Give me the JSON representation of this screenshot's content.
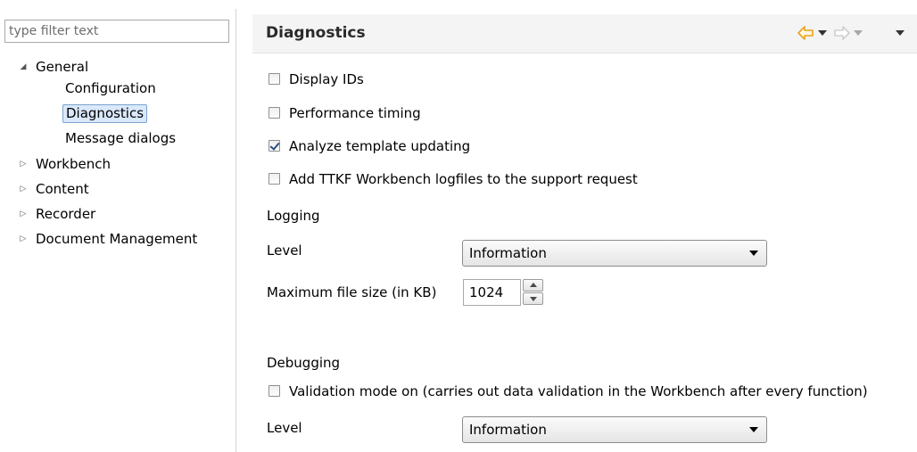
{
  "filter": {
    "placeholder": "type filter text"
  },
  "tree": {
    "general": {
      "label": "General",
      "children": [
        "Configuration",
        "Diagnostics",
        "Message dialogs"
      ]
    },
    "items": [
      "Workbench",
      "Content",
      "Recorder",
      "Document Management"
    ]
  },
  "header": {
    "title": "Diagnostics"
  },
  "checkboxes": [
    {
      "label": "Display IDs",
      "checked": false
    },
    {
      "label": "Performance timing",
      "checked": false
    },
    {
      "label": "Analyze template updating",
      "checked": true
    },
    {
      "label": "Add TTKF Workbench logfiles to the support request",
      "checked": false
    }
  ],
  "logging": {
    "title": "Logging",
    "level_label": "Level",
    "level_value": "Information",
    "max_size_label": "Maximum file size (in KB)",
    "max_size_value": "1024"
  },
  "debugging": {
    "title": "Debugging",
    "validation_label": "Validation mode on (carries out data validation in the Workbench after every function)",
    "validation_checked": false,
    "level_label": "Level",
    "level_value": "Information"
  },
  "colors": {
    "back_arrow": "#e8a41c",
    "forward_arrow": "#d3d3d3",
    "selection_bg": "#d9e8fb",
    "selection_border": "#7da2ce"
  }
}
